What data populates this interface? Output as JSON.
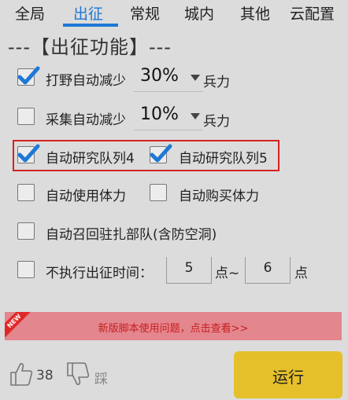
{
  "tabs": [
    {
      "label": "全局"
    },
    {
      "label": "出征",
      "active": true
    },
    {
      "label": "常规"
    },
    {
      "label": "城内"
    },
    {
      "label": "其他"
    },
    {
      "label": "云配置"
    }
  ],
  "section_title": "---【出征功能】---",
  "options": {
    "field_reduce": {
      "label": "打野自动减少",
      "checked": true,
      "value": "30%",
      "unit": "兵力"
    },
    "gather_reduce": {
      "label": "采集自动减少",
      "checked": false,
      "value": "10%",
      "unit": "兵力"
    },
    "research_queue_4": {
      "label": "自动研究队列4",
      "checked": true
    },
    "research_queue_5": {
      "label": "自动研究队列5",
      "checked": true
    },
    "use_stamina": {
      "label": "自动使用体力",
      "checked": false
    },
    "buy_stamina": {
      "label": "自动购买体力",
      "checked": false
    },
    "recall_troops": {
      "label": "自动召回驻扎部队(含防空洞)",
      "checked": false
    },
    "no_march_time": {
      "label": "不执行出征时间：",
      "checked": false,
      "from": "5",
      "from_unit": "点~",
      "to": "6",
      "to_unit": "点"
    }
  },
  "banner": {
    "tag": "NEW",
    "text": "新版脚本使用问题，点击查看>>"
  },
  "footer": {
    "like_count": "38",
    "dislike_label": "踩",
    "run_label": "运行"
  },
  "colors": {
    "accent": "#1e78d6",
    "checkbox": "#1e78d6",
    "highlight_border": "#d32323",
    "run_button": "#e6c02a",
    "banner_bg": "#e3868e",
    "banner_text": "#c81e1e"
  }
}
